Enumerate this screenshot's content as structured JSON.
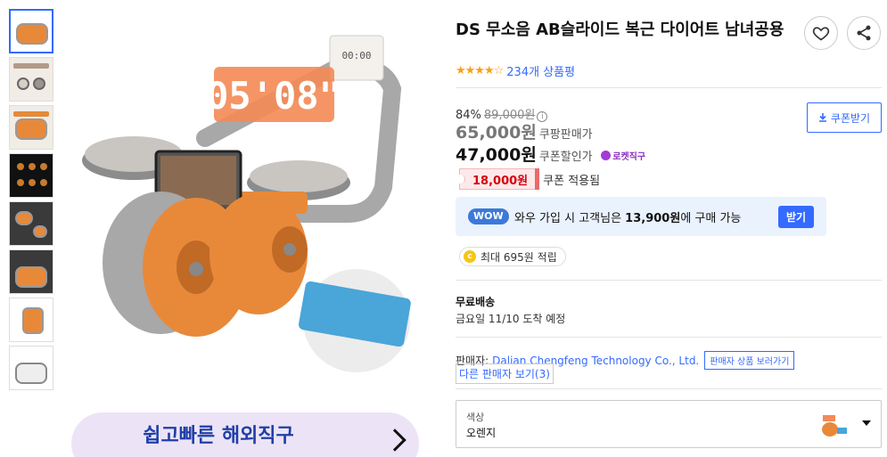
{
  "product": {
    "title": "DS 무소음 AB슬라이드 복근 다이어트 남녀공용",
    "rating_stars": "★★★★☆",
    "review_count": "234개 상품평"
  },
  "image": {
    "timer_display": "05'08\"",
    "mini_display": "00:00"
  },
  "promo": {
    "headline": "쉽고빠른 해외직구"
  },
  "price": {
    "discount_rate": "84%",
    "original_price": "89,000원",
    "coupang_price": "65,000원",
    "coupang_price_label": "쿠팡판매가",
    "coupon_price": "47,000원",
    "coupon_price_label": "쿠폰할인가",
    "rocket_label": "로켓직구",
    "coupon_button": "쿠폰받기",
    "coupon_amount": "18,000원",
    "coupon_applied_label": "쿠폰 적용됨"
  },
  "wow": {
    "badge": "WOW",
    "text_prefix": "와우 가입 시 고객님은 ",
    "text_amount": "13,900원",
    "text_suffix": "에 구매 가능",
    "button": "받기"
  },
  "points": {
    "icon_letter": "c",
    "text": "최대 695원 적립"
  },
  "shipping": {
    "title": "무료배송",
    "date": "금요일 11/10 도착 예정"
  },
  "seller": {
    "label": "판매자:",
    "name": "Dalian Chengfeng Technology Co., Ltd.",
    "view_products": "판매자 상품 보러가기",
    "other_sellers": "다른 판매자 보기(3)"
  },
  "option": {
    "label": "색상",
    "value": "오렌지"
  },
  "colors": {
    "accent": "#346aff",
    "orange": "#e8893a",
    "coupon_red": "#d7000f",
    "wow_bg": "#eaf2fe"
  }
}
